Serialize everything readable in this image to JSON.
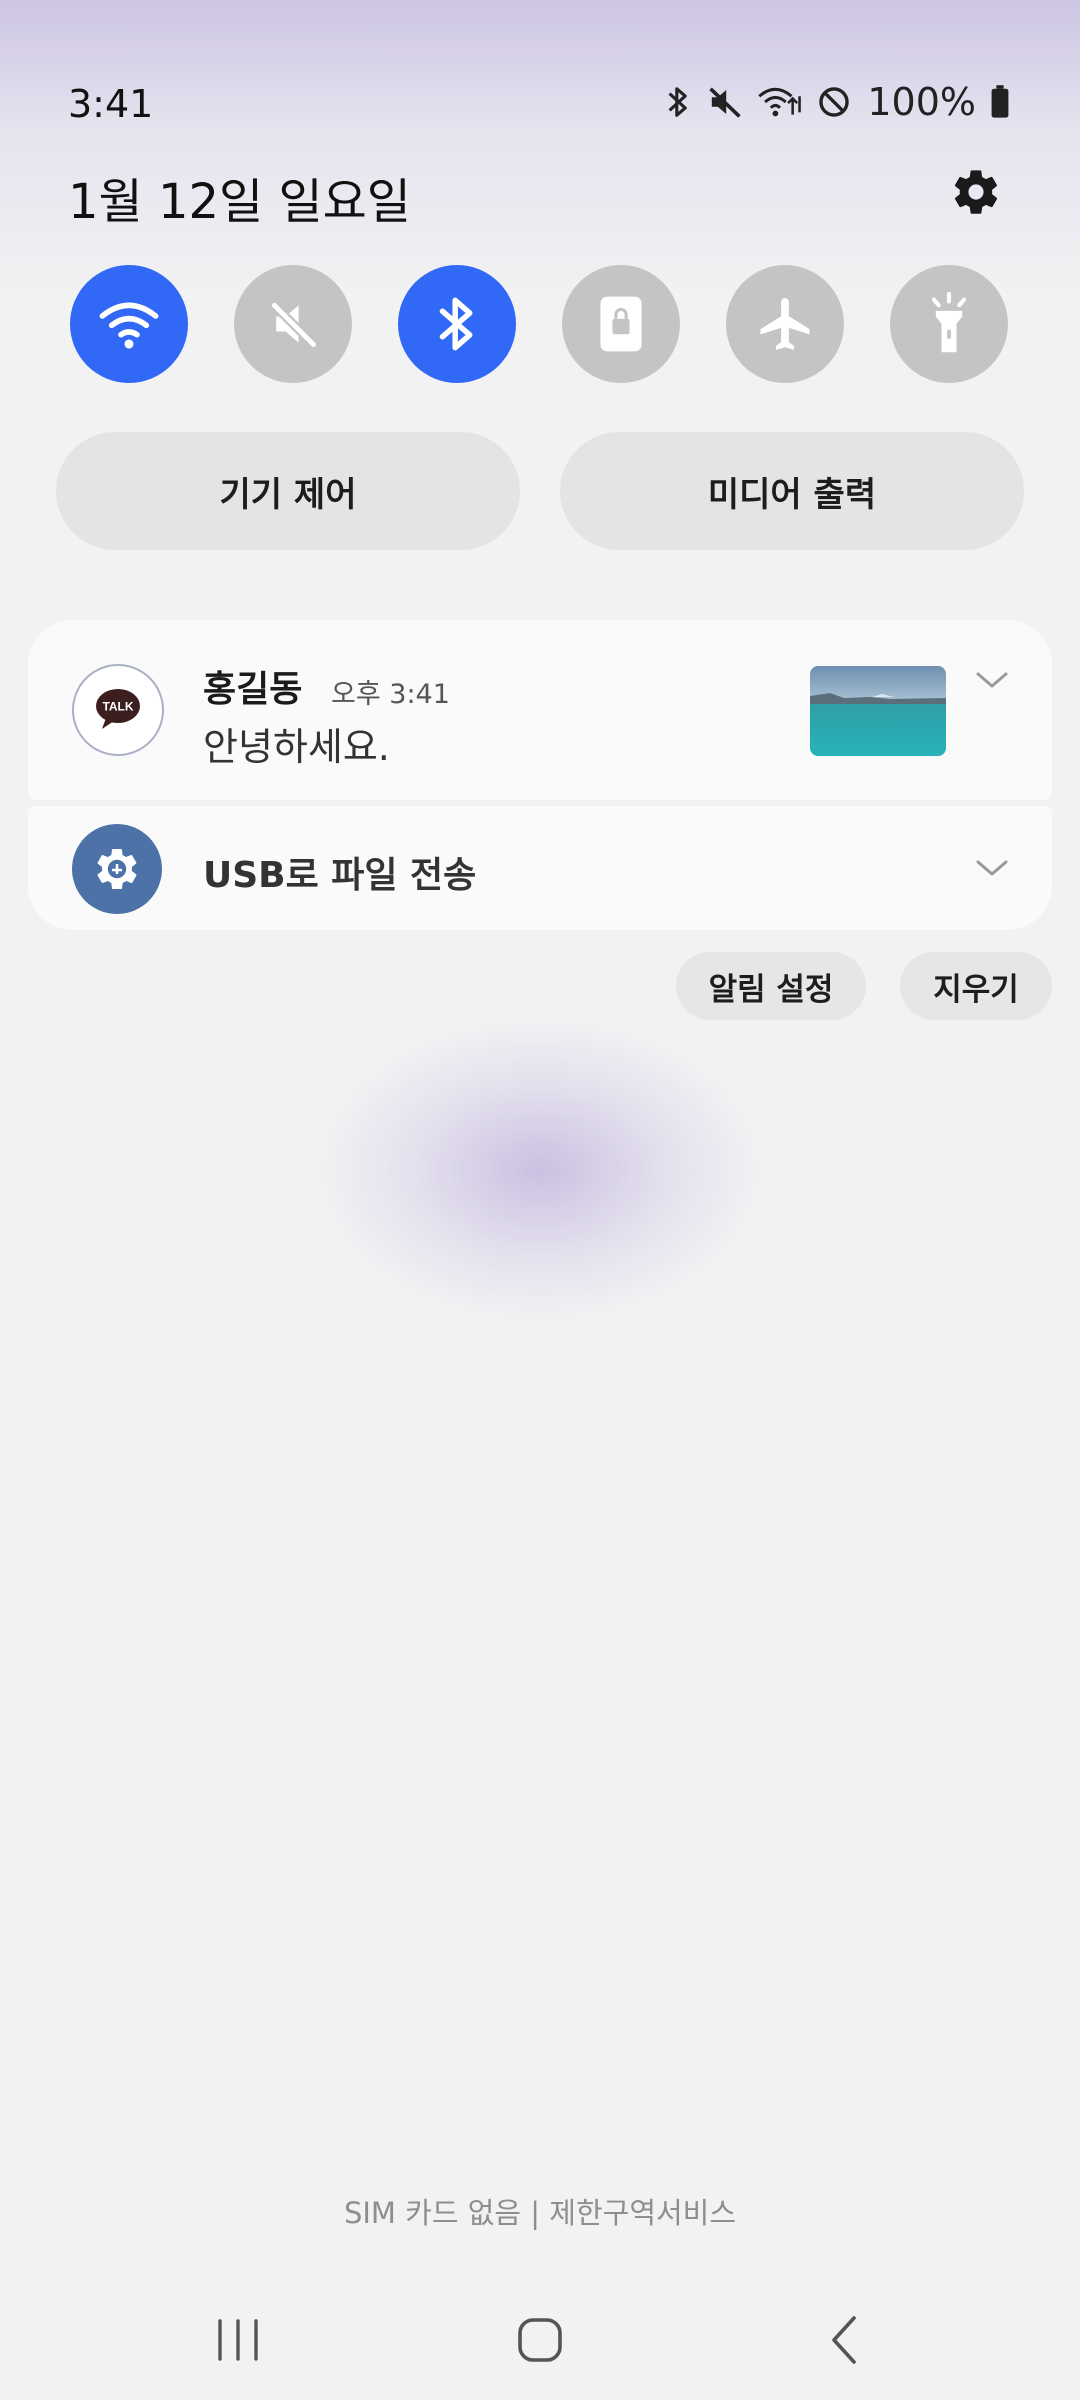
{
  "status_bar": {
    "time": "3:41",
    "battery_text": "100%",
    "icons": [
      "bluetooth-icon",
      "mute-icon",
      "wifi-data-icon",
      "do-not-disturb-icon",
      "battery-icon"
    ]
  },
  "header": {
    "date": "1월 12일 일요일",
    "settings_icon": "gear-icon"
  },
  "quick_settings": [
    {
      "name": "wifi",
      "icon": "wifi-icon",
      "active": true
    },
    {
      "name": "sound",
      "icon": "mute-icon",
      "active": false
    },
    {
      "name": "bluetooth",
      "icon": "bluetooth-icon",
      "active": true
    },
    {
      "name": "rotation-lock",
      "icon": "portrait-lock-icon",
      "active": false
    },
    {
      "name": "airplane-mode",
      "icon": "airplane-icon",
      "active": false
    },
    {
      "name": "flashlight",
      "icon": "flashlight-icon",
      "active": false
    }
  ],
  "controls": {
    "device_control": "기기 제어",
    "media_output": "미디어 출력"
  },
  "notifications": [
    {
      "app_icon": "kakaotalk-icon",
      "app_icon_text": "TALK",
      "sender": "홍길동",
      "time": "오후 3:41",
      "message": "안녕하세요."
    },
    {
      "app_icon": "usb-settings-icon",
      "title": "USB로 파일 전송"
    }
  ],
  "actions": {
    "notification_settings": "알림 설정",
    "clear": "지우기"
  },
  "carrier": "SIM 카드 없음 | 제한구역서비스",
  "nav_bar": [
    "recent-apps-icon",
    "home-icon",
    "back-icon"
  ],
  "colors": {
    "active_toggle": "#3168f6",
    "inactive_toggle": "#c4c4c6",
    "usb_icon_bg": "#4d72a8"
  }
}
